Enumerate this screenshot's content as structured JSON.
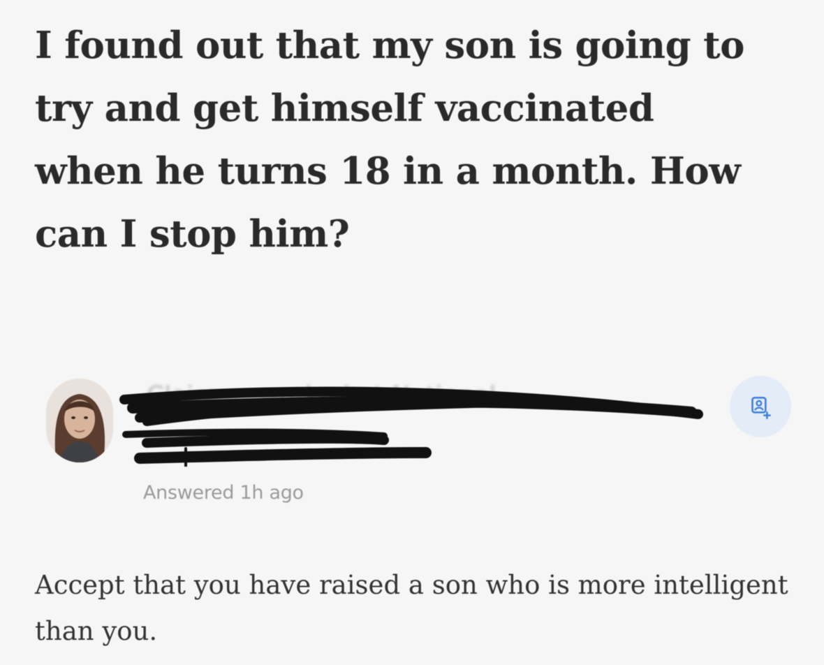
{
  "question": {
    "title": "I found out that my son is going to try and get himself vaccinated when he turns 18 in a month. How can I stop him?"
  },
  "author": {
    "name_redacted": "Claire ... worked at National ...",
    "answered_meta": "Answered 1h ago",
    "follow_icon": "follow-user-icon"
  },
  "answer": {
    "text": "Accept that you have raised a son who is more intelligent than you."
  },
  "colors": {
    "background": "#f6f6f6",
    "title_text": "#2a2a2a",
    "meta_text": "#9b9b9b",
    "follow_bg": "#e3ecf7",
    "follow_icon": "#3b7dd8",
    "redaction": "#111111"
  }
}
